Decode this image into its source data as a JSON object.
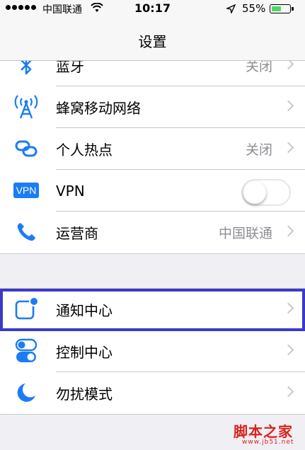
{
  "status_bar": {
    "carrier": "中国联通",
    "time": "10:17",
    "battery_percent": "55%",
    "battery_level": 0.55
  },
  "nav": {
    "title": "设置"
  },
  "group1": [
    {
      "label": "蓝牙",
      "detail": "关闭",
      "icon": "bluetooth-icon"
    },
    {
      "label": "蜂窝移动网络",
      "detail": "",
      "icon": "cellular-icon"
    },
    {
      "label": "个人热点",
      "detail": "关闭",
      "icon": "hotspot-icon"
    },
    {
      "label": "VPN",
      "detail": "",
      "icon": "vpn-icon",
      "badge": "VPN",
      "toggle_on": false
    },
    {
      "label": "运营商",
      "detail": "中国联通",
      "icon": "phone-icon"
    }
  ],
  "group2": [
    {
      "label": "通知中心",
      "detail": "",
      "icon": "notification-center-icon",
      "selected": true
    },
    {
      "label": "控制中心",
      "detail": "",
      "icon": "control-center-icon"
    },
    {
      "label": "勿扰模式",
      "detail": "",
      "icon": "moon-icon"
    }
  ],
  "watermark": {
    "text": "脚本之家",
    "sub": "www.jb51.net"
  },
  "colors": {
    "accent": "#1b7cf5",
    "selection_border": "#3a3ac8",
    "battery_fill": "#4cd964"
  }
}
